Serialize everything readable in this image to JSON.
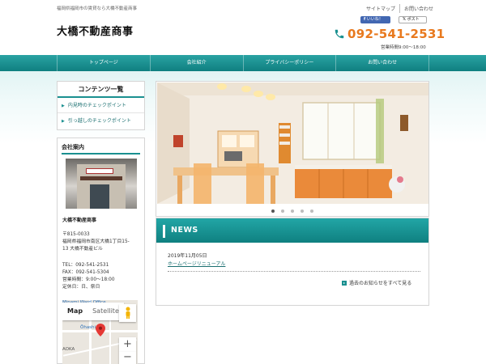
{
  "header": {
    "tagline": "福岡県福岡市の賃貸なら大橋不動産商事",
    "site_title": "大橋不動産商事",
    "top_links": [
      "サイトマップ",
      "お問い合わせ"
    ],
    "facebook_label": "いいね！",
    "twitter_label": "ポスト",
    "phone": "092-541-2531",
    "hours": "営業時間9:00～18:00",
    "phone_color": "#e8791e"
  },
  "nav": {
    "items": [
      "トップページ",
      "会社紹介",
      "プライバシーポリシー",
      "お問い合わせ"
    ]
  },
  "sidebar": {
    "contents_title": "コンテンツ一覧",
    "links": [
      "内見時のチェックポイント",
      "引っ越しのチェックポイント"
    ],
    "company_title": "会社案内",
    "company_name": "大橋不動産商事",
    "zip": "〒815-0033",
    "address_line1": "福岡県福岡市南区大橋1丁目15-",
    "address_line2": "13 大橋不動産ビル",
    "tel": "TEL：092-541-2531",
    "fax": "FAX：092-541-5304",
    "business_hours": "営業時間：9:00～18:00",
    "holidays": "定休日：日、祭日"
  },
  "map": {
    "tab_map": "Map",
    "tab_satellite": "Satellite",
    "label_ward": "Minami Ward Office",
    "label_station": "Ōhashi",
    "label_area": "AOKA"
  },
  "slider": {
    "dot_count": 5,
    "active_index": 0
  },
  "news": {
    "title": "NEWS",
    "date": "2019年11月05日",
    "headline": "ホームページリニューアル",
    "more_label": "過去のお知らせをすべて見る"
  },
  "colors": {
    "accent": "#1a9090",
    "nav_top": "#2aa3a3",
    "nav_bottom": "#0f7f80"
  }
}
